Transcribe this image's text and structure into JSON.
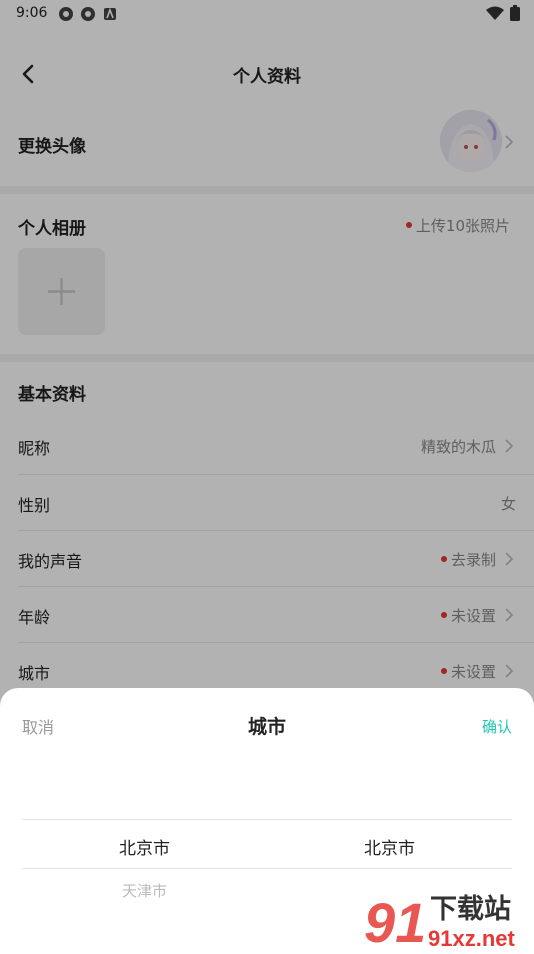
{
  "status_bar": {
    "time": "9:06"
  },
  "header": {
    "title": "个人资料"
  },
  "avatar_row": {
    "label": "更换头像"
  },
  "album": {
    "label": "个人相册",
    "hint": "上传10张照片"
  },
  "basic": {
    "title": "基本资料",
    "rows": [
      {
        "label": "昵称",
        "value": "精致的木瓜",
        "dot": false,
        "chevron": true
      },
      {
        "label": "性别",
        "value": "女",
        "dot": false,
        "chevron": false
      },
      {
        "label": "我的声音",
        "value": "去录制",
        "dot": true,
        "chevron": true
      },
      {
        "label": "年龄",
        "value": "未设置",
        "dot": true,
        "chevron": true
      },
      {
        "label": "城市",
        "value": "未设置",
        "dot": true,
        "chevron": true
      }
    ]
  },
  "sheet": {
    "cancel": "取消",
    "title": "城市",
    "confirm": "确认",
    "province_selected": "北京市",
    "city_selected": "北京市",
    "province_next": "天津市"
  },
  "watermark": {
    "text": "下载站",
    "domain": "91xz.net"
  },
  "colors": {
    "accent": "#22c9b5",
    "dot": "#e53935",
    "watermark": "#e53935"
  }
}
